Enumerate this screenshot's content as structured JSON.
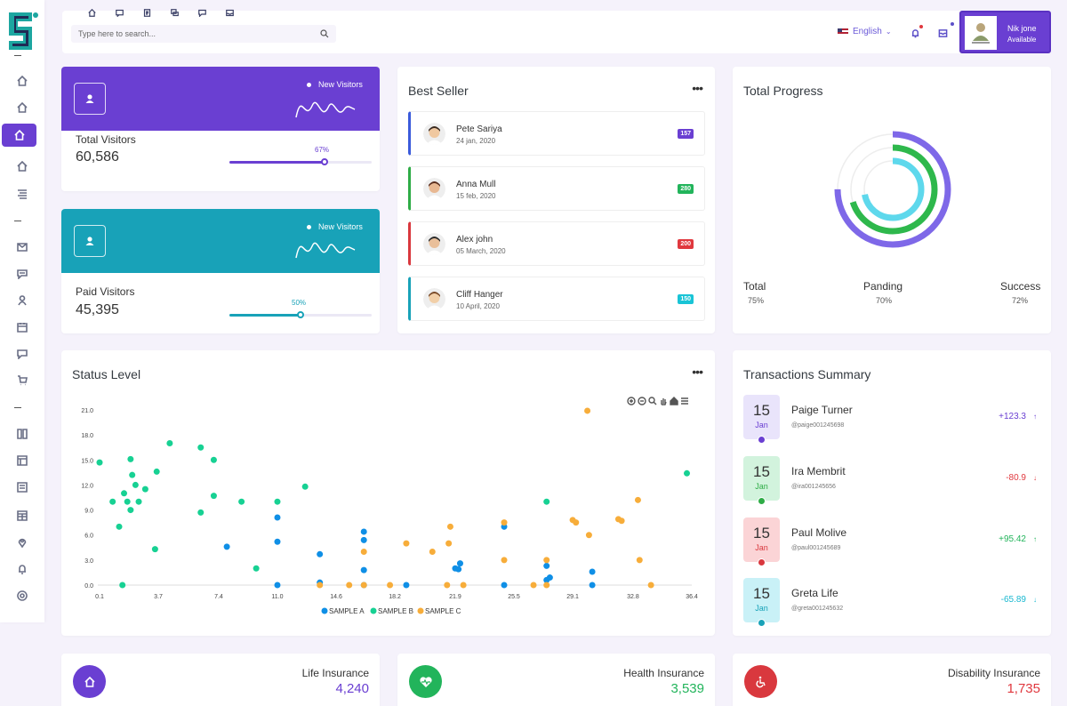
{
  "header": {
    "search_placeholder": "Type here to search...",
    "language": "English",
    "profile": {
      "name": "Nik jone",
      "status": "Available"
    },
    "icons": [
      "home-icon",
      "message-icon",
      "document-icon",
      "chat-icon",
      "comment-icon",
      "inbox-icon"
    ]
  },
  "sidebar": {
    "icons": [
      "home-icon",
      "home-icon",
      "home-icon",
      "home-icon",
      "list-icon",
      "mail-icon",
      "chat-icon",
      "user-icon",
      "calendar-icon",
      "comment-icon",
      "cart-icon",
      "columns-icon",
      "layout-icon",
      "form-icon",
      "table-icon",
      "map-pin-icon",
      "bell-icon",
      "circle-icon"
    ],
    "active_index": 2
  },
  "visitors": [
    {
      "label": "Total Visitors",
      "value": "60,586",
      "badge": "New Visitors",
      "percent_label": "67%",
      "percent": 67,
      "color": "#6a3fd2"
    },
    {
      "label": "Paid Visitors",
      "value": "45,395",
      "badge": "New Visitors",
      "percent_label": "50%",
      "percent": 50,
      "color": "#18a2b8"
    }
  ],
  "best_seller": {
    "title": "Best Seller",
    "more": "•••",
    "items": [
      {
        "name": "Pete Sariya",
        "date": "24 jan, 2020",
        "badge": "157",
        "color": "#3b5bdb",
        "badge_color": "#6a3fd2"
      },
      {
        "name": "Anna Mull",
        "date": "15 feb, 2020",
        "badge": "280",
        "color": "#2eac46",
        "badge_color": "#22b45b"
      },
      {
        "name": "Alex john",
        "date": "05 March, 2020",
        "badge": "200",
        "color": "#d9383e",
        "badge_color": "#e0383e"
      },
      {
        "name": "Cliff Hanger",
        "date": "10 April, 2020",
        "badge": "150",
        "color": "#18a2b8",
        "badge_color": "#19c4d6"
      }
    ]
  },
  "total_progress": {
    "title": "Total Progress",
    "columns": [
      {
        "label": "Total",
        "value": "75%",
        "fraction": 0.75,
        "color": "#7e68e8"
      },
      {
        "label": "Panding",
        "value": "70%",
        "fraction": 0.7,
        "color": "#2eb84c"
      },
      {
        "label": "Success",
        "value": "72%",
        "fraction": 0.72,
        "color": "#5ed8ec"
      }
    ]
  },
  "status_level": {
    "title": "Status Level",
    "more": "•••",
    "tool_icons": [
      "zoom-in-icon",
      "zoom-out-icon",
      "magnifier-icon",
      "pan-hand-icon",
      "reset-home-icon",
      "menu-icon"
    ]
  },
  "chart_data": {
    "type": "scatter",
    "title": "Status Level",
    "xlabel": "",
    "ylabel": "",
    "xlim": [
      0.1,
      36.4
    ],
    "ylim": [
      0,
      21
    ],
    "x_ticks": [
      "0.1",
      "3.7",
      "7.4",
      "11.0",
      "14.6",
      "18.2",
      "21.9",
      "25.5",
      "29.1",
      "32.8",
      "36.4"
    ],
    "y_ticks": [
      "0.0",
      "3.0",
      "6.0",
      "9.0",
      "12.0",
      "15.0",
      "18.0",
      "21.0"
    ],
    "legend_position": "bottom",
    "series": [
      {
        "name": "SAMPLE A",
        "color": "#0f8fe6",
        "points": [
          [
            7.9,
            4.6
          ],
          [
            11.0,
            8.1
          ],
          [
            11.0,
            5.2
          ],
          [
            11.0,
            0.0
          ],
          [
            13.6,
            3.7
          ],
          [
            13.6,
            0.3
          ],
          [
            16.3,
            6.4
          ],
          [
            16.3,
            5.4
          ],
          [
            16.3,
            1.8
          ],
          [
            16.3,
            0.0
          ],
          [
            18.9,
            0.0
          ],
          [
            21.9,
            2.0
          ],
          [
            22.1,
            1.9
          ],
          [
            22.2,
            2.6
          ],
          [
            24.9,
            7.0
          ],
          [
            24.9,
            0.0
          ],
          [
            27.5,
            0.6
          ],
          [
            27.5,
            2.3
          ],
          [
            27.7,
            0.9
          ],
          [
            30.3,
            1.6
          ],
          [
            30.3,
            0.0
          ]
        ]
      },
      {
        "name": "SAMPLE B",
        "color": "#17d193",
        "points": [
          [
            0.1,
            14.7
          ],
          [
            0.9,
            10.0
          ],
          [
            1.3,
            7.0
          ],
          [
            1.5,
            0.0
          ],
          [
            1.6,
            11.0
          ],
          [
            1.8,
            10.0
          ],
          [
            2.0,
            9.0
          ],
          [
            2.0,
            15.1
          ],
          [
            2.1,
            13.2
          ],
          [
            2.3,
            12.0
          ],
          [
            2.5,
            10.0
          ],
          [
            2.9,
            11.5
          ],
          [
            3.5,
            4.3
          ],
          [
            3.6,
            13.6
          ],
          [
            4.4,
            17.0
          ],
          [
            6.3,
            8.7
          ],
          [
            6.3,
            16.5
          ],
          [
            7.1,
            10.7
          ],
          [
            7.1,
            15.0
          ],
          [
            8.8,
            10.0
          ],
          [
            9.7,
            2.0
          ],
          [
            11.0,
            10.0
          ],
          [
            12.7,
            11.8
          ],
          [
            27.5,
            10.0
          ],
          [
            36.1,
            13.4
          ]
        ]
      },
      {
        "name": "SAMPLE C",
        "color": "#f7ad3a",
        "points": [
          [
            13.6,
            0.0
          ],
          [
            15.4,
            0.0
          ],
          [
            16.3,
            0.0
          ],
          [
            16.3,
            4.0
          ],
          [
            17.9,
            0.0
          ],
          [
            18.9,
            5.0
          ],
          [
            20.5,
            4.0
          ],
          [
            21.4,
            0.0
          ],
          [
            21.5,
            5.0
          ],
          [
            21.6,
            7.0
          ],
          [
            22.4,
            0.0
          ],
          [
            24.9,
            3.0
          ],
          [
            24.9,
            7.5
          ],
          [
            26.7,
            0.0
          ],
          [
            27.5,
            0.0
          ],
          [
            27.5,
            3.0
          ],
          [
            29.1,
            7.8
          ],
          [
            29.3,
            7.5
          ],
          [
            30.1,
            6.0
          ],
          [
            30.0,
            20.9
          ],
          [
            31.9,
            7.9
          ],
          [
            32.1,
            7.7
          ],
          [
            33.1,
            10.2
          ],
          [
            33.2,
            3.0
          ],
          [
            33.9,
            0.0
          ]
        ]
      }
    ]
  },
  "transactions": {
    "title": "Transactions Summary",
    "items": [
      {
        "day": "15",
        "month": "Jan",
        "name": "Paige Turner",
        "id": "@paige001245698",
        "amount": "+123.3",
        "arrow": "↑",
        "color": "#6a3fd2",
        "bg": "#e9e4fb"
      },
      {
        "day": "15",
        "month": "Jan",
        "name": "Ira Membrit",
        "id": "@ira001245656",
        "amount": "-80.9",
        "arrow": "↓",
        "color": "#e0383e",
        "bg": "#d2f3dd",
        "dot": "#2eac46",
        "month_color": "#2eac46"
      },
      {
        "day": "15",
        "month": "Jan",
        "name": "Paul Molive",
        "id": "@paul001245689",
        "amount": "+95.42",
        "arrow": "↑",
        "color": "#22b45b",
        "bg": "#fbd4d6",
        "dot": "#d9383e",
        "month_color": "#d9383e"
      },
      {
        "day": "15",
        "month": "Jan",
        "name": "Greta Life",
        "id": "@greta001245632",
        "amount": "-65.89",
        "arrow": "↓",
        "color": "#19b8d0",
        "bg": "#c9f1f7",
        "dot": "#18a2b8",
        "month_color": "#18a2b8"
      }
    ]
  },
  "insurance": [
    {
      "label": "Life Insurance",
      "value": "4,240",
      "color": "#6a3fd2",
      "icon": "home-icon"
    },
    {
      "label": "Health Insurance",
      "value": "3,539",
      "color": "#22b45b",
      "icon": "heart-pulse-icon"
    },
    {
      "label": "Disability Insurance",
      "value": "1,735",
      "color": "#d9383e",
      "icon": "wheelchair-icon"
    }
  ]
}
